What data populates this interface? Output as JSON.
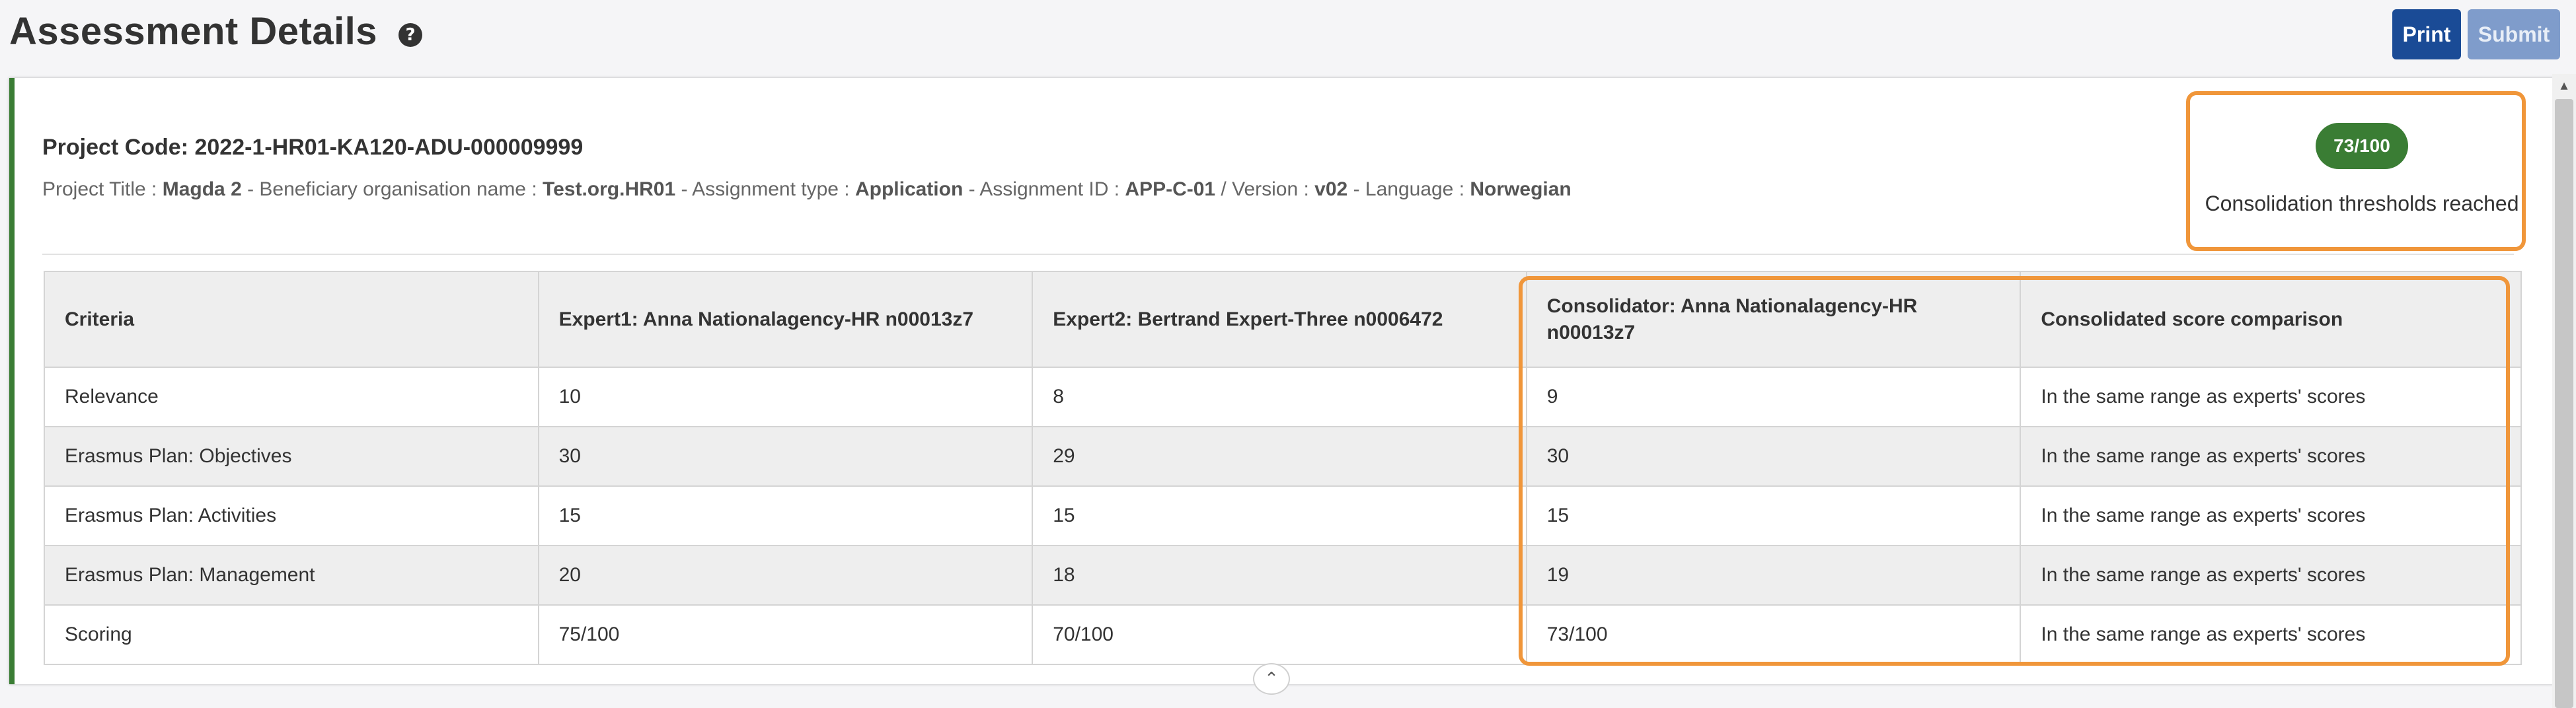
{
  "header": {
    "title": "Assessment Details",
    "help_icon": "?",
    "print_label": "Print",
    "submit_label": "Submit"
  },
  "project": {
    "code": "Project Code: 2022-1-HR01-KA120-ADU-000009999",
    "title_label": "Project Title : ",
    "title_value": "Magda 2",
    "beneficiary_label": " - Beneficiary organisation name : ",
    "beneficiary_value": "Test.org.HR01",
    "assignment_type_label": " - Assignment type : ",
    "assignment_type_value": "Application",
    "assignment_id_label": " - Assignment ID : ",
    "assignment_id_value": "APP-C-01",
    "version_label": " / Version : ",
    "version_value": "v02",
    "language_label": " - Language : ",
    "language_value": "Norwegian"
  },
  "score": {
    "value": "73/100",
    "status": "Consolidation thresholds reached",
    "color": "#3a7d34"
  },
  "table": {
    "headers": [
      "Criteria",
      "Expert1: Anna Nationalagency-HR n00013z7",
      "Expert2: Bertrand Expert-Three n0006472",
      "Consolidator: Anna Nationalagency-HR n00013z7",
      "Consolidated score comparison"
    ],
    "rows": [
      [
        "Relevance",
        "10",
        "8",
        "9",
        "In the same range as experts' scores"
      ],
      [
        "Erasmus Plan: Objectives",
        "30",
        "29",
        "30",
        "In the same range as experts' scores"
      ],
      [
        "Erasmus Plan: Activities",
        "15",
        "15",
        "15",
        "In the same range as experts' scores"
      ],
      [
        "Erasmus Plan: Management",
        "20",
        "18",
        "19",
        "In the same range as experts' scores"
      ],
      [
        "Scoring",
        "75/100",
        "70/100",
        "73/100",
        "In the same range as experts' scores"
      ]
    ]
  },
  "icons": {
    "collapse": "chevron-up-icon",
    "scroll_up": "scroll-up-arrow-icon"
  },
  "colors": {
    "accent_green": "#3a7d34",
    "print_button": "#1a4b96",
    "submit_button_disabled": "#7f9ccb",
    "highlight": "#f0963a"
  }
}
